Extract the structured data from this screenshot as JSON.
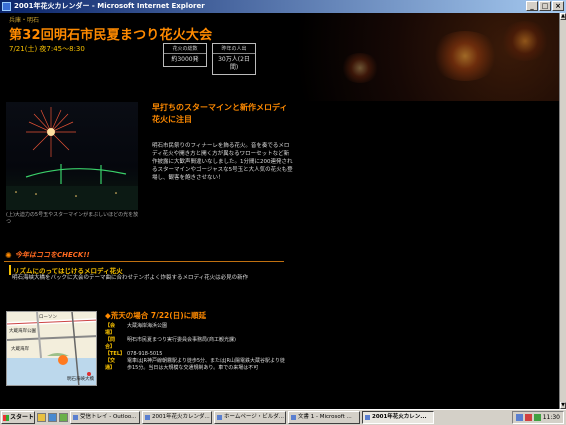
{
  "window": {
    "title": "2001年花火カレンダー - Microsoft Internet Explorer",
    "controls": [
      "_",
      "□",
      "×"
    ]
  },
  "page": {
    "breadcrumb": "兵庫・明石",
    "headline": "第32回明石市民夏まつり花火大会",
    "datetime": "7/21(土)  夜7:45〜8:30",
    "info_boxes": [
      {
        "label": "花火の総数",
        "value": "約3000発"
      },
      {
        "label": "昨年の人出",
        "value": "30万人(2日間)"
      }
    ],
    "photo_caption": "(上)大迫力の5号玉やスターマインがまぶしいほどの光を放つ",
    "lead": "早打ちのスターマインと新作メロディ花火に注目",
    "body": "明石市民祭りのフィナーレを飾る花火。音を奏でるメロディ花火や開き方と開く方が異なるワローセットなど新作披露に大歓声間違いなしました。1分間に200連発されるスターマインやゴージャスな5号玉と大人気の花火も登場し、観客を飽きさせない！",
    "section_tag": "今年はココをCHECK!!",
    "highlight_title": "リズムにのってはじけるメロディ花火",
    "highlight_desc": "明石海峡大橋をバックに大会のテーマ曲に合わせテンポよく炸裂するメロディ花火は必見の新作",
    "rain_note": "◆荒天の場合  7/22(日)に順延",
    "details": [
      {
        "label": "【会　場】",
        "value": "大蔵海岸海浜公園"
      },
      {
        "label": "【問　合】",
        "value": "明石市民夏まつり実行委員会事務局(商工観光課)"
      },
      {
        "label": "【TEL】",
        "value": "078-918-5015"
      },
      {
        "label": "【交　通】",
        "value": "電車はJR神戸線朝霧駅より徒歩5分、またはJR山陽電鉄大蔵谷駅より徒歩15分。当日は大規模な交通規制あり。車での来場は不可"
      }
    ],
    "map_labels": [
      "ローソン",
      "大蔵海岸公園",
      "大蔵海岸",
      "明石海峡大橋"
    ]
  },
  "taskbar": {
    "start": "スタート",
    "buttons": [
      {
        "label": "受信トレイ - Outloo...",
        "active": false
      },
      {
        "label": "2001年花火カレンダ...",
        "active": false
      },
      {
        "label": "ホームページ・ビルダ...",
        "active": false
      },
      {
        "label": "文書 1 - Microsoft ...",
        "active": false
      },
      {
        "label": "2001年花火カレン...",
        "active": true
      }
    ],
    "clock": "11:30"
  }
}
